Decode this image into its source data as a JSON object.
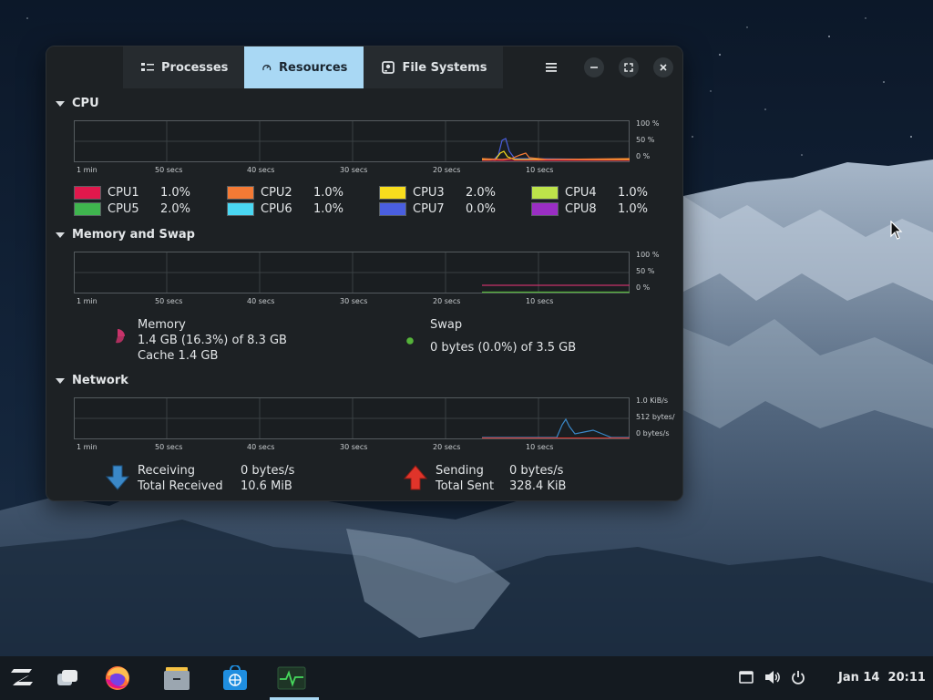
{
  "window": {
    "tabs": [
      {
        "label": "Processes",
        "icon": "list-icon"
      },
      {
        "label": "Resources",
        "icon": "gauge-icon"
      },
      {
        "label": "File Systems",
        "icon": "disk-icon"
      }
    ],
    "active_tab": "Resources"
  },
  "time_axis": [
    "1 min",
    "50 secs",
    "40 secs",
    "30 secs",
    "20 secs",
    "10 secs"
  ],
  "cpu": {
    "title": "CPU",
    "y_labels": [
      "100 %",
      "50 %",
      "0 %"
    ],
    "cores": [
      {
        "name": "CPU1",
        "value": "1.0%",
        "color": "#e0184c"
      },
      {
        "name": "CPU2",
        "value": "1.0%",
        "color": "#f47a35"
      },
      {
        "name": "CPU3",
        "value": "2.0%",
        "color": "#f8dd1d"
      },
      {
        "name": "CPU4",
        "value": "1.0%",
        "color": "#bde34a"
      },
      {
        "name": "CPU5",
        "value": "2.0%",
        "color": "#3fb54e"
      },
      {
        "name": "CPU6",
        "value": "1.0%",
        "color": "#4ad7f2"
      },
      {
        "name": "CPU7",
        "value": "0.0%",
        "color": "#4a5fe0"
      },
      {
        "name": "CPU8",
        "value": "1.0%",
        "color": "#9a2ec4"
      }
    ]
  },
  "memory": {
    "title": "Memory and Swap",
    "y_labels": [
      "100 %",
      "50 %",
      "0 %"
    ],
    "memory_label": "Memory",
    "memory_value": "1.4 GB (16.3%) of 8.3 GB",
    "cache_value": "Cache 1.4 GB",
    "memory_color": "#c8336a",
    "swap_label": "Swap",
    "swap_value": "0 bytes (0.0%) of 3.5 GB",
    "swap_color": "#55b33a"
  },
  "network": {
    "title": "Network",
    "y_labels": [
      "1.0 KiB/s",
      "512 bytes/",
      "0 bytes/s"
    ],
    "receiving_label": "Receiving",
    "receiving_value": "0 bytes/s",
    "total_received_label": "Total Received",
    "total_received_value": "10.6 MiB",
    "sending_label": "Sending",
    "sending_value": "0 bytes/s",
    "total_sent_label": "Total Sent",
    "total_sent_value": "328.4 KiB",
    "receive_color": "#3a88c8",
    "send_color": "#e0342a"
  },
  "taskbar": {
    "apps": [
      "zorin-menu-icon",
      "workspaces-icon",
      "firefox-icon",
      "files-icon",
      "software-store-icon",
      "system-monitor-icon"
    ],
    "clock": "Jan 14  20:11",
    "tray": [
      "screen-icon",
      "volume-icon",
      "power-icon"
    ]
  }
}
